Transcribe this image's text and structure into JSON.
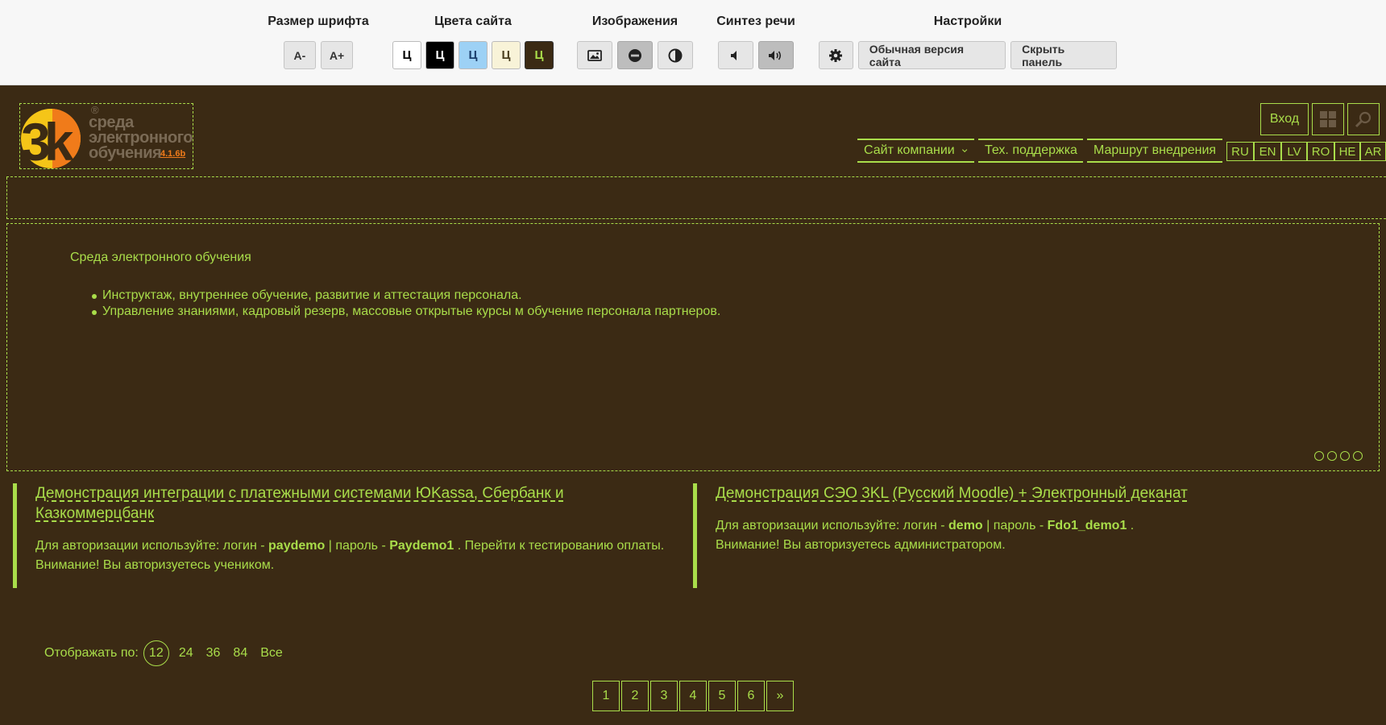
{
  "panel": {
    "font_size": {
      "title": "Размер шрифта",
      "decrease": "A-",
      "increase": "A+"
    },
    "colors": {
      "title": "Цвета сайта",
      "swatches": [
        {
          "label": "Ц",
          "bg": "#ffffff",
          "fg": "#000000"
        },
        {
          "label": "Ц",
          "bg": "#000000",
          "fg": "#ffffff"
        },
        {
          "label": "Ц",
          "bg": "#9dd1f5",
          "fg": "#1a3d6b"
        },
        {
          "label": "Ц",
          "bg": "#f8f3d8",
          "fg": "#4a3f1f"
        },
        {
          "label": "Ц",
          "bg": "#3b2a14",
          "fg": "#a9dd4a"
        }
      ]
    },
    "images": {
      "title": "Изображения"
    },
    "speech": {
      "title": "Синтез речи"
    },
    "settings": {
      "title": "Настройки",
      "normal_version": "Обычная версия сайта",
      "hide_panel": "Скрыть панель"
    }
  },
  "header": {
    "logo_text_line1": "среда",
    "logo_text_line2": "электронного",
    "logo_text_line3": "обучения",
    "logo_version": "4.1.6b",
    "logo_reg": "®",
    "login": "Вход",
    "menu": [
      "Сайт компании",
      "Тех. поддержка",
      "Маршрут внедрения"
    ],
    "languages": [
      "RU",
      "EN",
      "LV",
      "RO",
      "HE",
      "AR"
    ]
  },
  "banner": {
    "title": "Среда электронного обучения",
    "items": [
      "Инструктаж, внутреннее обучение, развитие и аттестация персонала.",
      "Управление знаниями, кадровый резерв, массовые открытые курсы м обучение персонала партнеров."
    ]
  },
  "cards": [
    {
      "title": "Демонстрация интеграции с платежными системами ЮKassa, Сбербанк и Казкоммерцбанк",
      "prefix": "Для авторизации используйте: логин - ",
      "login": "paydemo",
      "sep": " | пароль - ",
      "password": "Paydemo1",
      "suffix": " . Перейти к тестированию оплаты.",
      "note": "Внимание! Вы авторизуетесь учеником."
    },
    {
      "title": "Демонстрация СЭО 3KL (Русский Moodle) + Электронный деканат",
      "prefix": "Для авторизации используйте: логин - ",
      "login": "demo",
      "sep": " | пароль - ",
      "password": "Fdo1_demo1",
      "suffix": " .",
      "note": "Внимание! Вы авторизуетесь администратором."
    }
  ],
  "perpage": {
    "label": "Отображать по:",
    "options": [
      "12",
      "24",
      "36",
      "84",
      "Все"
    ],
    "selected": "12"
  },
  "pager": [
    "1",
    "2",
    "3",
    "4",
    "5",
    "6",
    "»"
  ],
  "colors": {
    "background": "#3b2a14",
    "accent": "#a9dd4a",
    "logo_orange": "#f07b1a",
    "logo_yellow": "#f5c518"
  }
}
